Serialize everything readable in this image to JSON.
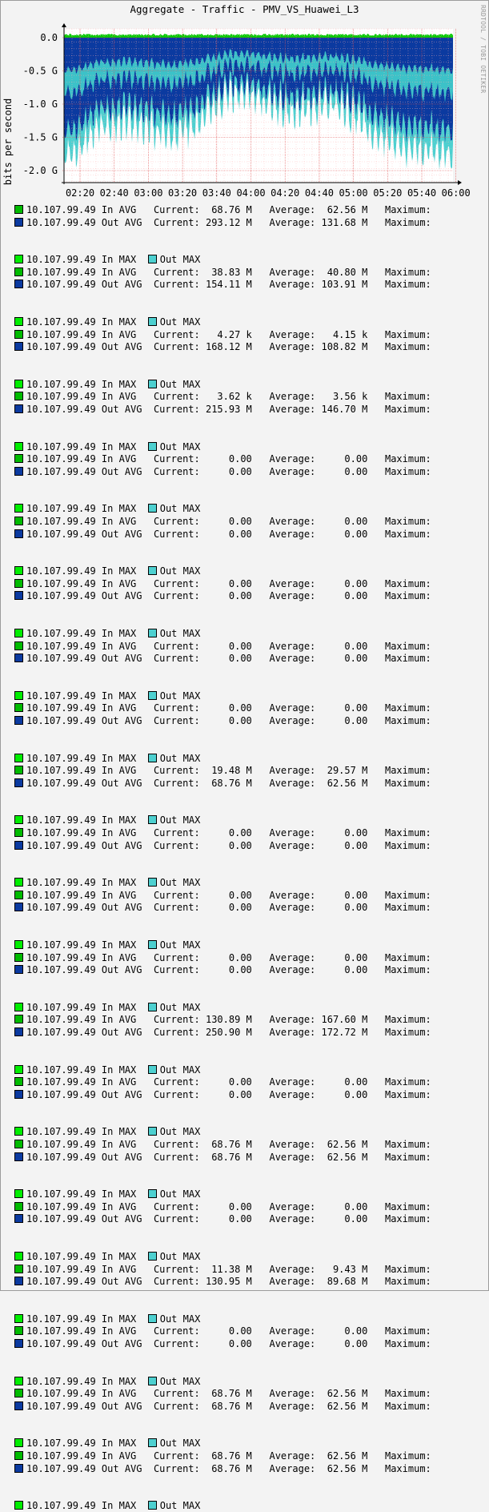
{
  "title": "Aggregate - Traffic - PMV_VS_Huawei_L3",
  "watermark": "RRDTOOL / TOBI OETIKER",
  "chart_data": {
    "type": "area",
    "ylabel": "bits per second",
    "y_ticks": [
      "0.0",
      "-0.5 G",
      "-1.0 G",
      "-1.5 G",
      "-2.0 G"
    ],
    "y_tick_values": [
      0,
      -0.5,
      -1.0,
      -1.5,
      -2.0
    ],
    "ylim": [
      -2.2,
      0.05
    ],
    "x_ticks": [
      "02:20",
      "02:40",
      "03:00",
      "03:20",
      "03:40",
      "04:00",
      "04:20",
      "04:40",
      "05:00",
      "05:20",
      "05:40",
      "06:00"
    ],
    "grid": true,
    "series": [
      {
        "name": "10.107.99.49 In MAX",
        "color": "#00cc00"
      },
      {
        "name": "Out MAX",
        "color": "#4dd0d0"
      },
      {
        "name": "10.107.99.49 In AVG",
        "color": "#009900"
      },
      {
        "name": "10.107.99.49 Out AVG",
        "color": "#00338a"
      }
    ]
  },
  "legend": {
    "in_max": "10.107.99.49 In MAX",
    "out_max": "Out MAX",
    "in_avg": "10.107.99.49 In AVG",
    "out_avg": "10.107.99.49 Out AVG",
    "current": "Current:",
    "average": "Average:",
    "maximum": "Maximum:",
    "colors": {
      "in_max": "#00ee00",
      "out_max": "#4dd0d0",
      "in_avg": "#00bb00",
      "out_avg": "#0b3aa0"
    }
  },
  "groups": [
    {
      "show_max": false,
      "in_cur": "68.76 M",
      "in_avg": "62.56 M",
      "out_cur": "293.12 M",
      "out_avg": "131.68 M"
    },
    {
      "show_max": true,
      "in_cur": "38.83 M",
      "in_avg": "40.80 M",
      "out_cur": "154.11 M",
      "out_avg": "103.91 M"
    },
    {
      "show_max": true,
      "in_cur": "4.27 k",
      "in_avg": "4.15 k",
      "out_cur": "168.12 M",
      "out_avg": "108.82 M"
    },
    {
      "show_max": true,
      "in_cur": "3.62 k",
      "in_avg": "3.56 k",
      "out_cur": "215.93 M",
      "out_avg": "146.70 M"
    },
    {
      "show_max": true,
      "in_cur": "0.00",
      "in_avg": "0.00",
      "out_cur": "0.00",
      "out_avg": "0.00"
    },
    {
      "show_max": true,
      "in_cur": "0.00",
      "in_avg": "0.00",
      "out_cur": "0.00",
      "out_avg": "0.00"
    },
    {
      "show_max": true,
      "in_cur": "0.00",
      "in_avg": "0.00",
      "out_cur": "0.00",
      "out_avg": "0.00"
    },
    {
      "show_max": true,
      "in_cur": "0.00",
      "in_avg": "0.00",
      "out_cur": "0.00",
      "out_avg": "0.00"
    },
    {
      "show_max": true,
      "in_cur": "0.00",
      "in_avg": "0.00",
      "out_cur": "0.00",
      "out_avg": "0.00"
    },
    {
      "show_max": true,
      "in_cur": "19.48 M",
      "in_avg": "29.57 M",
      "out_cur": "68.76 M",
      "out_avg": "62.56 M"
    },
    {
      "show_max": true,
      "in_cur": "0.00",
      "in_avg": "0.00",
      "out_cur": "0.00",
      "out_avg": "0.00"
    },
    {
      "show_max": true,
      "in_cur": "0.00",
      "in_avg": "0.00",
      "out_cur": "0.00",
      "out_avg": "0.00"
    },
    {
      "show_max": true,
      "in_cur": "0.00",
      "in_avg": "0.00",
      "out_cur": "0.00",
      "out_avg": "0.00"
    },
    {
      "show_max": true,
      "in_cur": "130.89 M",
      "in_avg": "167.60 M",
      "out_cur": "250.90 M",
      "out_avg": "172.72 M"
    },
    {
      "show_max": true,
      "in_cur": "0.00",
      "in_avg": "0.00",
      "out_cur": "0.00",
      "out_avg": "0.00"
    },
    {
      "show_max": true,
      "in_cur": "68.76 M",
      "in_avg": "62.56 M",
      "out_cur": "68.76 M",
      "out_avg": "62.56 M"
    },
    {
      "show_max": true,
      "in_cur": "0.00",
      "in_avg": "0.00",
      "out_cur": "0.00",
      "out_avg": "0.00"
    },
    {
      "show_max": true,
      "in_cur": "11.38 M",
      "in_avg": "9.43 M",
      "out_cur": "130.95 M",
      "out_avg": "89.68 M"
    },
    {
      "show_max": true,
      "in_cur": "0.00",
      "in_avg": "0.00",
      "out_cur": "0.00",
      "out_avg": "0.00"
    },
    {
      "show_max": true,
      "in_cur": "68.76 M",
      "in_avg": "62.56 M",
      "out_cur": "68.76 M",
      "out_avg": "62.56 M"
    },
    {
      "show_max": true,
      "in_cur": "68.76 M",
      "in_avg": "62.56 M",
      "out_cur": "68.76 M",
      "out_avg": "62.56 M"
    }
  ],
  "trailing_max_line": true
}
